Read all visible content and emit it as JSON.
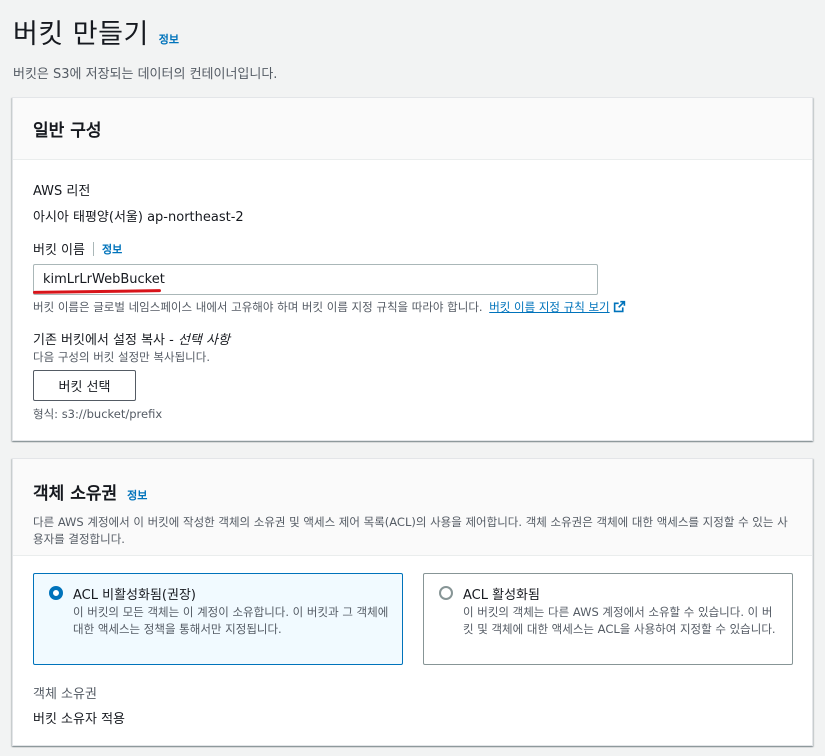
{
  "header": {
    "title": "버킷 만들기",
    "info_link": "정보",
    "description": "버킷은 S3에 저장되는 데이터의 컨테이너입니다."
  },
  "general": {
    "title": "일반 구성",
    "region_label": "AWS 리전",
    "region_value": "아시아 태평양(서울) ap-northeast-2",
    "bucket_name_label": "버킷 이름",
    "bucket_name_info": "정보",
    "bucket_name_value": "kimLrLrWebBucket",
    "bucket_name_hint": "버킷 이름은 글로벌 네임스페이스 내에서 고유해야 하며 버킷 이름 지정 규칙을 따라야 합니다.",
    "naming_rules_link": "버킷 이름 지정 규칙 보기",
    "copy_label": "기존 버킷에서 설정 복사 -",
    "copy_optional": "선택 사항",
    "copy_desc": "다음 구성의 버킷 설정만 복사됩니다.",
    "choose_bucket_button": "버킷 선택",
    "format_hint": "형식: s3://bucket/prefix"
  },
  "ownership": {
    "title": "객체 소유권",
    "info_link": "정보",
    "description": "다른 AWS 계정에서 이 버킷에 작성한 객체의 소유권 및 액세스 제어 목록(ACL)의 사용을 제어합니다. 객체 소유권은 객체에 대한 액세스를 지정할 수 있는 사용자를 결정합니다.",
    "options": [
      {
        "title": "ACL 비활성화됨(권장)",
        "description": "이 버킷의 모든 객체는 이 계정이 소유합니다. 이 버킷과 그 객체에 대한 액세스는 정책을 통해서만 지정됩니다.",
        "selected": true
      },
      {
        "title": "ACL 활성화됨",
        "description": "이 버킷의 객체는 다른 AWS 계정에서 소유할 수 있습니다. 이 버킷 및 객체에 대한 액세스는 ACL을 사용하여 지정할 수 있습니다.",
        "selected": false
      }
    ],
    "owner_label": "객체 소유권",
    "owner_value": "버킷 소유자 적용"
  },
  "colors": {
    "link": "#0073bb",
    "annotation_underline": "#d8141a",
    "selected_tile_bg": "#f1faff"
  }
}
